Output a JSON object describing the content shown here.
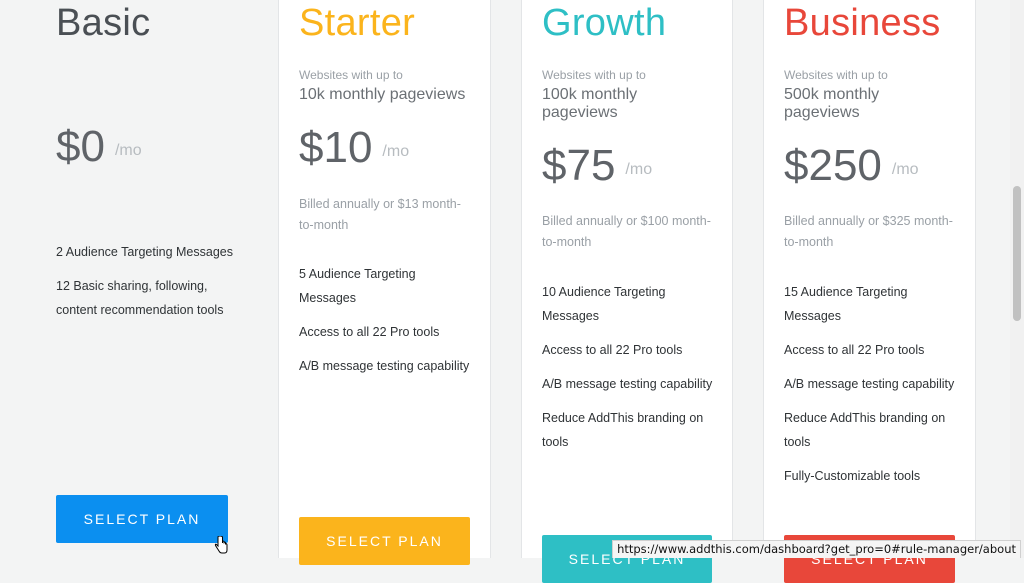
{
  "plans": [
    {
      "name": "Basic",
      "subtitle_small": "",
      "subtitle_big": "",
      "price": "$0",
      "period": "/mo",
      "billing": "",
      "features": [
        "2 Audience Targeting Messages",
        "12 Basic sharing, following, content recommendation tools"
      ],
      "cta": "SELECT PLAN",
      "color": "#0b8ff0",
      "title_color": "#4a4f54"
    },
    {
      "name": "Starter",
      "subtitle_small": "Websites with up to",
      "subtitle_big": "10k monthly pageviews",
      "price": "$10",
      "period": "/mo",
      "billing": "Billed annually or $13 month-to-month",
      "features": [
        "5 Audience Targeting Messages",
        "Access to all 22 Pro tools",
        "A/B message testing capability"
      ],
      "cta": "SELECT PLAN",
      "color": "#fbb41c",
      "title_color": "#fbb41c"
    },
    {
      "name": "Growth",
      "subtitle_small": "Websites with up to",
      "subtitle_big": "100k monthly pageviews",
      "price": "$75",
      "period": "/mo",
      "billing": "Billed annually or $100 month-to-month",
      "features": [
        "10 Audience Targeting Messages",
        "Access to all 22 Pro tools",
        "A/B message testing capability",
        "Reduce AddThis branding on tools"
      ],
      "cta": "SELECT PLAN",
      "color": "#2ebfc5",
      "title_color": "#2ebfc5"
    },
    {
      "name": "Business",
      "subtitle_small": "Websites with up to",
      "subtitle_big": "500k monthly pageviews",
      "price": "$250",
      "period": "/mo",
      "billing": "Billed annually or $325 month-to-month",
      "features": [
        "15 Audience Targeting Messages",
        "Access to all 22 Pro tools",
        "A/B message testing capability",
        "Reduce AddThis branding on tools",
        "Fully-Customizable tools"
      ],
      "cta": "SELECT PLAN",
      "color": "#e8473a",
      "title_color": "#e8473a"
    }
  ],
  "status_url": "https://www.addthis.com/dashboard?get_pro=0#rule-manager/about",
  "cursor_icon": "hand-pointer-icon"
}
